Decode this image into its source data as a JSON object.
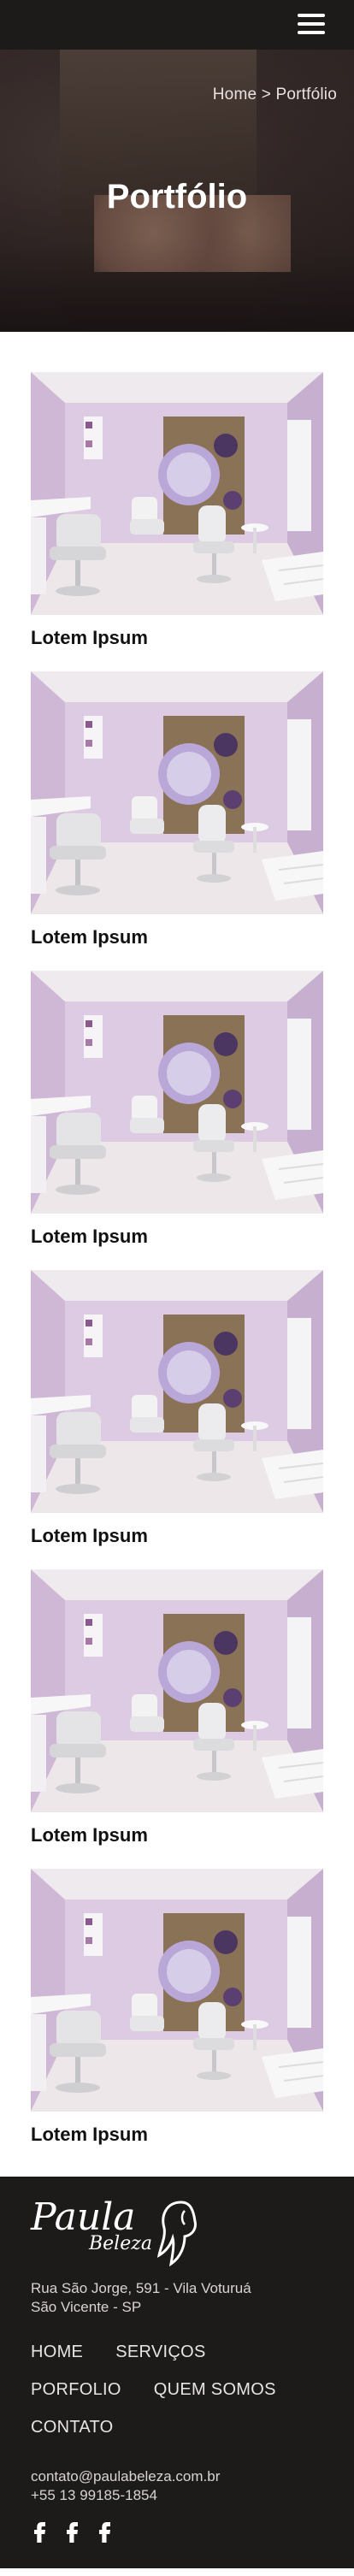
{
  "header": {
    "menu_icon": "hamburger-menu-icon"
  },
  "hero": {
    "breadcrumb": "Home > Portfólio",
    "title": "Portfólio"
  },
  "portfolio": {
    "items": [
      {
        "title": "Lotem Ipsum"
      },
      {
        "title": "Lotem Ipsum"
      },
      {
        "title": "Lotem Ipsum"
      },
      {
        "title": "Lotem Ipsum"
      },
      {
        "title": "Lotem Ipsum"
      },
      {
        "title": "Lotem Ipsum"
      }
    ]
  },
  "footer": {
    "logo": {
      "line1": "Paula",
      "line2": "Beleza"
    },
    "address": [
      "Rua São Jorge, 591 -  Vila Voturuá",
      "São Vicente - SP"
    ],
    "nav": [
      "HOME",
      "SERVIÇOS",
      "PORFOLIO",
      "QUEM SOMOS",
      "CONTATO"
    ],
    "email": "contato@paulabeleza.com.br",
    "phone": "+55 13 99185-1854",
    "social": [
      "facebook-icon",
      "facebook-icon",
      "facebook-icon"
    ]
  },
  "colors": {
    "dark": "#1d1a1a",
    "white": "#ffffff",
    "wall_lilac": "#d7c6dc",
    "floor": "#ece5e8"
  }
}
